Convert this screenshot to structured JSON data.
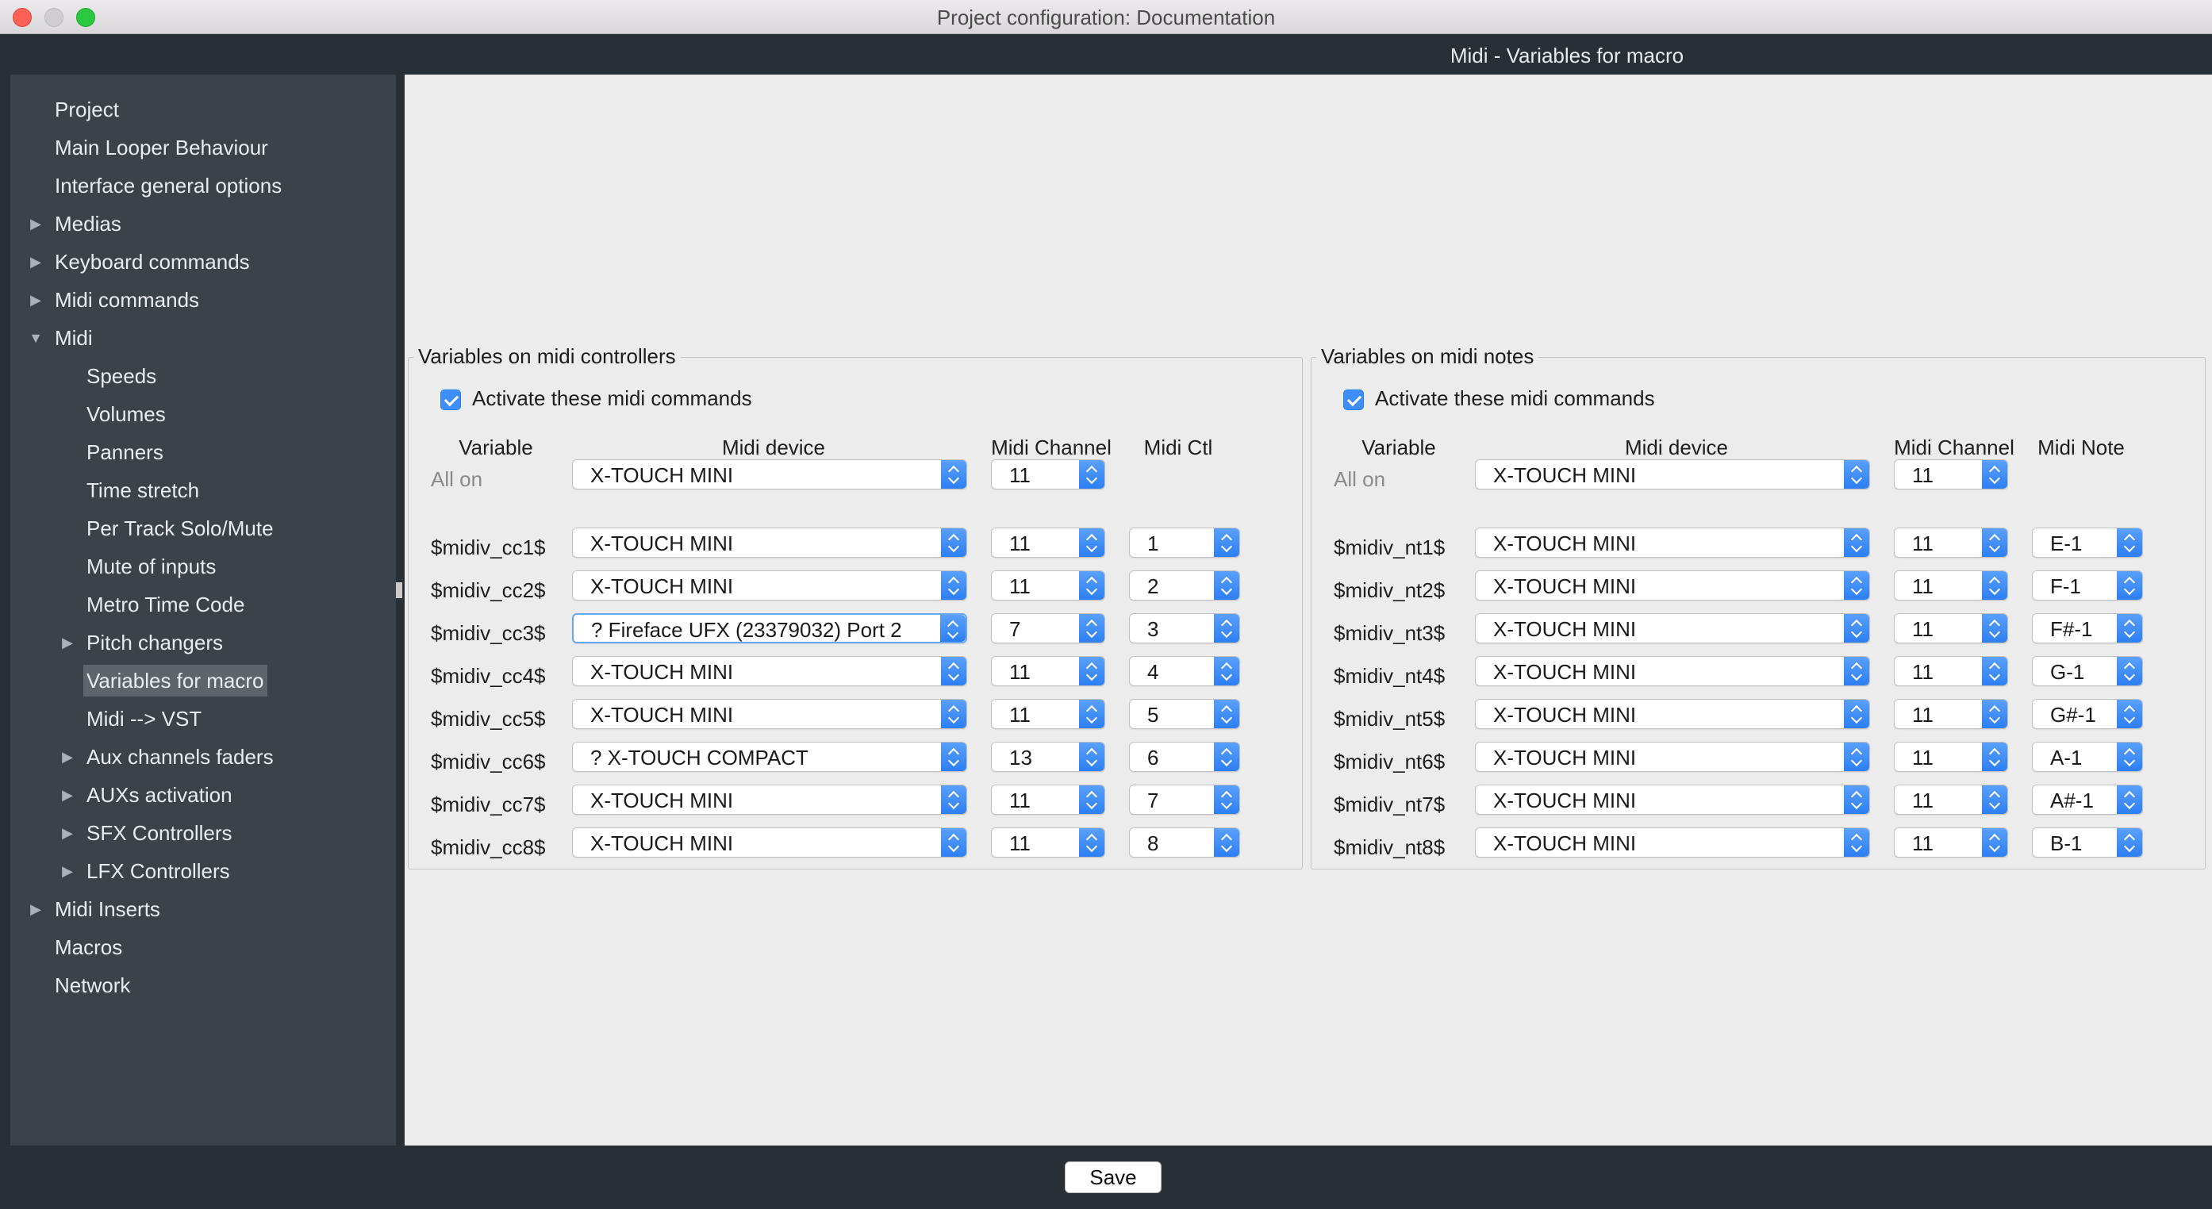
{
  "window": {
    "title": "Project configuration: Documentation"
  },
  "header": {
    "title": "Midi - Variables for macro"
  },
  "sidebar": {
    "items": [
      {
        "label": "Project",
        "level": 0,
        "arrow": ""
      },
      {
        "label": "Main Looper Behaviour",
        "level": 0,
        "arrow": ""
      },
      {
        "label": "Interface general options",
        "level": 0,
        "arrow": ""
      },
      {
        "label": "Medias",
        "level": 0,
        "arrow": "▶"
      },
      {
        "label": "Keyboard commands",
        "level": 0,
        "arrow": "▶"
      },
      {
        "label": "Midi commands",
        "level": 0,
        "arrow": "▶"
      },
      {
        "label": "Midi",
        "level": 0,
        "arrow": "▼"
      },
      {
        "label": "Speeds",
        "level": 1,
        "arrow": ""
      },
      {
        "label": "Volumes",
        "level": 1,
        "arrow": ""
      },
      {
        "label": "Panners",
        "level": 1,
        "arrow": ""
      },
      {
        "label": "Time stretch",
        "level": 1,
        "arrow": ""
      },
      {
        "label": "Per Track Solo/Mute",
        "level": 1,
        "arrow": ""
      },
      {
        "label": "Mute of inputs",
        "level": 1,
        "arrow": ""
      },
      {
        "label": "Metro Time Code",
        "level": 1,
        "arrow": ""
      },
      {
        "label": "Pitch changers",
        "level": 1,
        "arrow": "▶"
      },
      {
        "label": "Variables for macro",
        "level": 1,
        "arrow": "",
        "selected": true
      },
      {
        "label": "Midi --> VST",
        "level": 1,
        "arrow": ""
      },
      {
        "label": "Aux channels faders",
        "level": 1,
        "arrow": "▶"
      },
      {
        "label": "AUXs activation",
        "level": 1,
        "arrow": "▶"
      },
      {
        "label": "SFX Controllers",
        "level": 1,
        "arrow": "▶"
      },
      {
        "label": "LFX Controllers",
        "level": 1,
        "arrow": "▶"
      },
      {
        "label": "Midi Inserts",
        "level": 0,
        "arrow": "▶"
      },
      {
        "label": "Macros",
        "level": 0,
        "arrow": ""
      },
      {
        "label": "Network",
        "level": 0,
        "arrow": ""
      }
    ]
  },
  "controllers": {
    "title": "Variables on midi controllers",
    "activate_label": "Activate these midi commands",
    "activate_checked": true,
    "headers": {
      "variable": "Variable",
      "device": "Midi device",
      "channel": "Midi Channel",
      "extra": "Midi Ctl"
    },
    "all_on": {
      "label": "All on",
      "device": "X-TOUCH MINI",
      "channel": "11"
    },
    "rows": [
      {
        "variable": "$midiv_cc1$",
        "device": "X-TOUCH MINI",
        "channel": "11",
        "value": "1"
      },
      {
        "variable": "$midiv_cc2$",
        "device": "X-TOUCH MINI",
        "channel": "11",
        "value": "2"
      },
      {
        "variable": "$midiv_cc3$",
        "device": "? Fireface UFX (23379032) Port 2",
        "channel": "7",
        "value": "3"
      },
      {
        "variable": "$midiv_cc4$",
        "device": "X-TOUCH MINI",
        "channel": "11",
        "value": "4"
      },
      {
        "variable": "$midiv_cc5$",
        "device": "X-TOUCH MINI",
        "channel": "11",
        "value": "5"
      },
      {
        "variable": "$midiv_cc6$",
        "device": "? X-TOUCH COMPACT",
        "channel": "13",
        "value": "6"
      },
      {
        "variable": "$midiv_cc7$",
        "device": "X-TOUCH MINI",
        "channel": "11",
        "value": "7"
      },
      {
        "variable": "$midiv_cc8$",
        "device": "X-TOUCH MINI",
        "channel": "11",
        "value": "8"
      }
    ]
  },
  "notes": {
    "title": "Variables on midi notes",
    "activate_label": "Activate these midi commands",
    "activate_checked": true,
    "headers": {
      "variable": "Variable",
      "device": "Midi device",
      "channel": "Midi Channel",
      "extra": "Midi Note"
    },
    "all_on": {
      "label": "All on",
      "device": "X-TOUCH MINI",
      "channel": "11"
    },
    "rows": [
      {
        "variable": "$midiv_nt1$",
        "device": "X-TOUCH MINI",
        "channel": "11",
        "value": "E-1"
      },
      {
        "variable": "$midiv_nt2$",
        "device": "X-TOUCH MINI",
        "channel": "11",
        "value": "F-1"
      },
      {
        "variable": "$midiv_nt3$",
        "device": "X-TOUCH MINI",
        "channel": "11",
        "value": "F#-1"
      },
      {
        "variable": "$midiv_nt4$",
        "device": "X-TOUCH MINI",
        "channel": "11",
        "value": "G-1"
      },
      {
        "variable": "$midiv_nt5$",
        "device": "X-TOUCH MINI",
        "channel": "11",
        "value": "G#-1"
      },
      {
        "variable": "$midiv_nt6$",
        "device": "X-TOUCH MINI",
        "channel": "11",
        "value": "A-1"
      },
      {
        "variable": "$midiv_nt7$",
        "device": "X-TOUCH MINI",
        "channel": "11",
        "value": "A#-1"
      },
      {
        "variable": "$midiv_nt8$",
        "device": "X-TOUCH MINI",
        "channel": "11",
        "value": "B-1"
      }
    ]
  },
  "footer": {
    "save_label": "Save"
  }
}
